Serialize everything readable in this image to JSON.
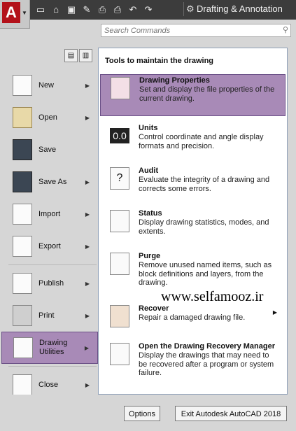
{
  "header": {
    "app_logo": "A",
    "workspace": "Drafting & Annotation",
    "qat_icons": [
      "new-icon",
      "open-icon",
      "save-icon",
      "saveas-icon",
      "print-icon",
      "plot-icon",
      "undo-icon",
      "redo-icon"
    ]
  },
  "search": {
    "placeholder": "Search Commands"
  },
  "menu": {
    "items": [
      {
        "label": "New"
      },
      {
        "label": "Open"
      },
      {
        "label": "Save"
      },
      {
        "label": "Save As"
      },
      {
        "label": "Import"
      },
      {
        "label": "Export"
      },
      {
        "label": "Publish"
      },
      {
        "label": "Print"
      },
      {
        "label": "Drawing Utilities"
      },
      {
        "label": "Close"
      }
    ]
  },
  "panel": {
    "title": "Tools to maintain the drawing",
    "items": [
      {
        "title": "Drawing Properties",
        "desc": "Set and display the file properties of the current drawing."
      },
      {
        "title": "Units",
        "desc": "Control coordinate and angle display formats and precision.",
        "icon_text": "0.0"
      },
      {
        "title": "Audit",
        "desc": "Evaluate the integrity of a drawing and corrects some errors.",
        "icon_text": "?"
      },
      {
        "title": "Status",
        "desc": "Display drawing statistics, modes, and extents."
      },
      {
        "title": "Purge",
        "desc": "Remove unused named items, such as block definitions and layers, from the drawing."
      },
      {
        "title": "Recover",
        "desc": "Repair a damaged drawing file."
      },
      {
        "title": "Open the Drawing Recovery Manager",
        "desc": "Display the drawings that may need to be recovered after a program or system failure."
      }
    ]
  },
  "watermark": "www.selfamooz.ir",
  "footer": {
    "options": "Options",
    "exit": "Exit Autodesk AutoCAD 2018"
  },
  "colors": {
    "selection": "#a88ab7",
    "topbar": "#3c3c3c",
    "accent_red": "#b3111a"
  }
}
